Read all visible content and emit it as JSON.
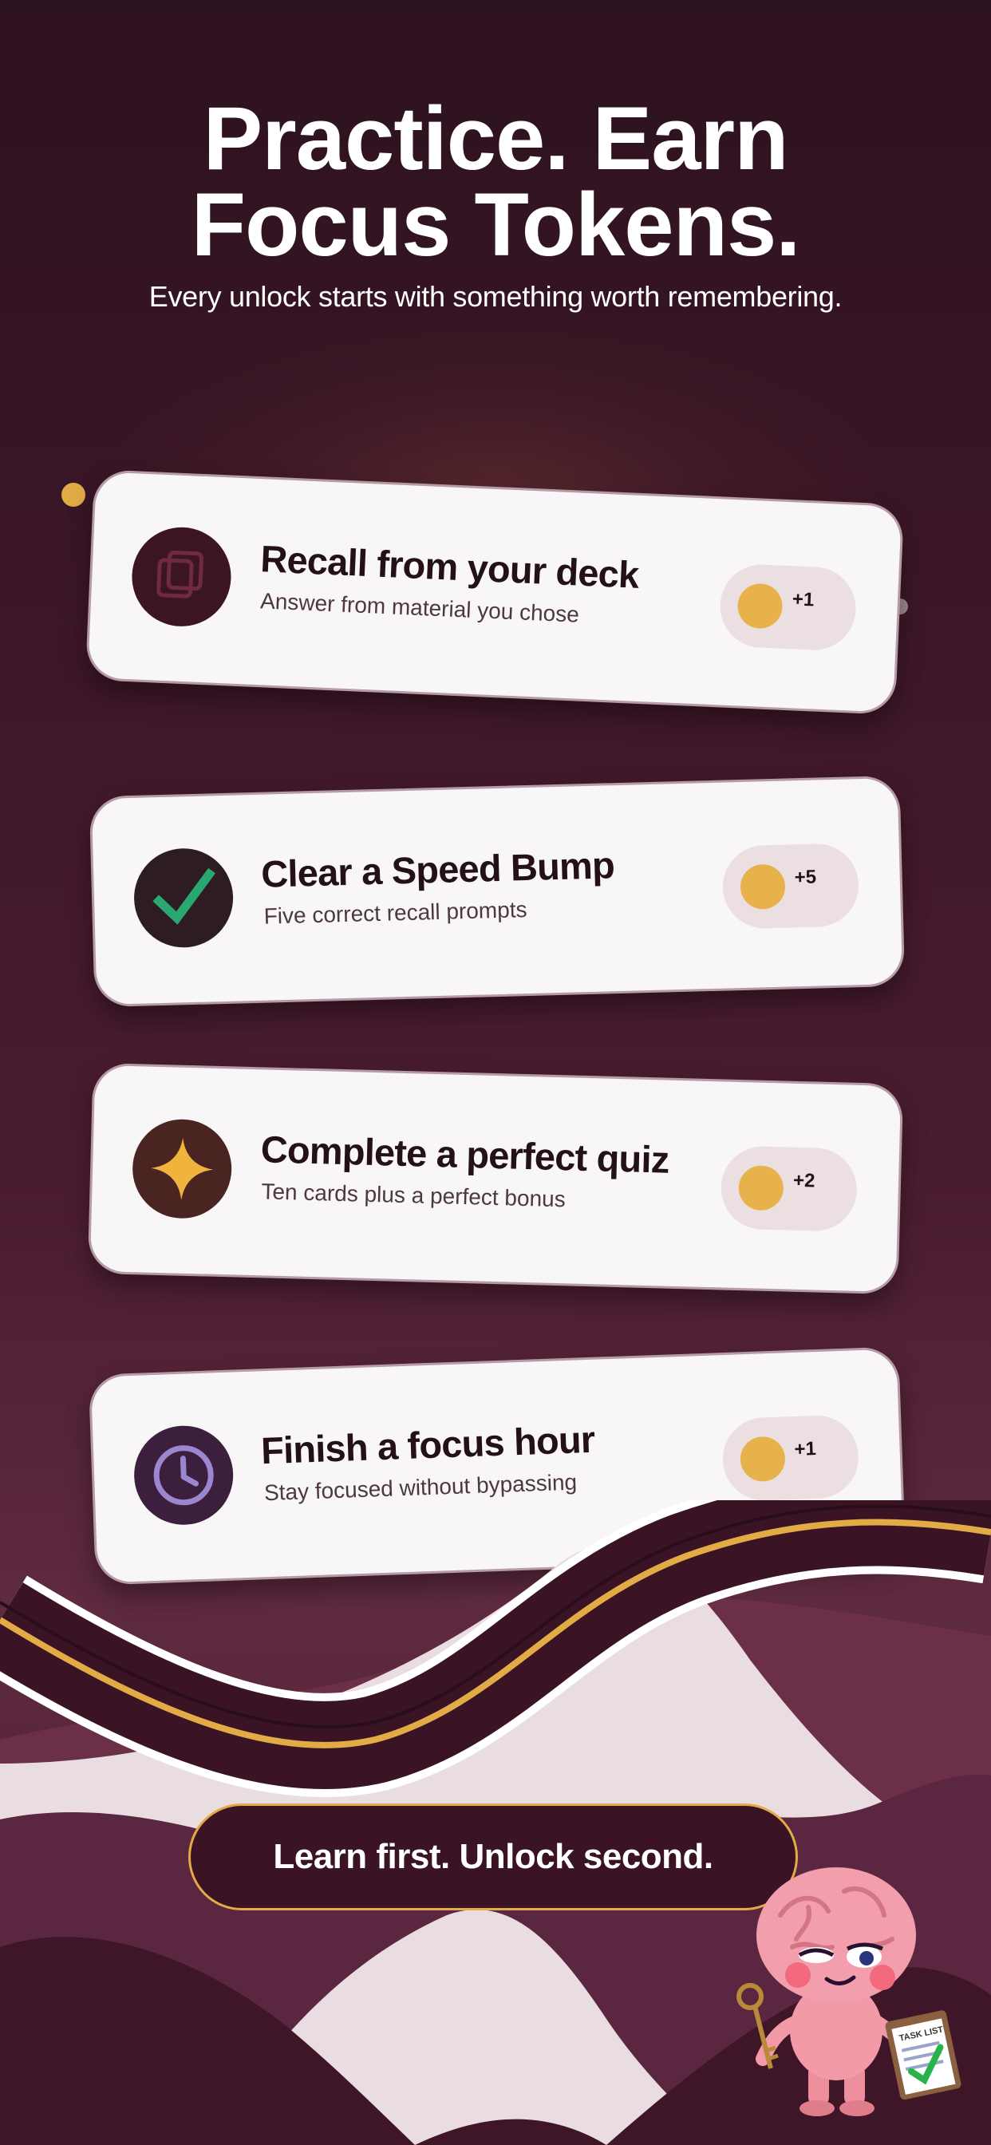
{
  "headline": {
    "line1": "Practice. Earn",
    "line2": "Focus Tokens."
  },
  "subhead": "Every unlock starts with something worth remembering.",
  "cards": [
    {
      "title": "Recall from your deck",
      "description": "Answer from material you chose",
      "reward": "+1",
      "icon": "cards-icon"
    },
    {
      "title": "Clear a Speed Bump",
      "description": "Five correct recall prompts",
      "reward": "+5",
      "icon": "checkmark-icon"
    },
    {
      "title": "Complete a perfect quiz",
      "description": "Ten cards plus a perfect bonus",
      "reward": "+2",
      "icon": "star-icon"
    },
    {
      "title": "Finish a focus hour",
      "description": "Stay focused without bypassing",
      "reward": "+1",
      "icon": "clock-icon"
    }
  ],
  "cta": {
    "label": "Learn first. Unlock second."
  },
  "mascot": {
    "clipboard_text": "TASK LIST"
  },
  "colors": {
    "accent_gold": "#e2ab45",
    "background_maroon": "#3a1626",
    "card_white": "#f8f6f6",
    "check_green": "#2aa872",
    "clock_purple": "#9b86d0"
  }
}
